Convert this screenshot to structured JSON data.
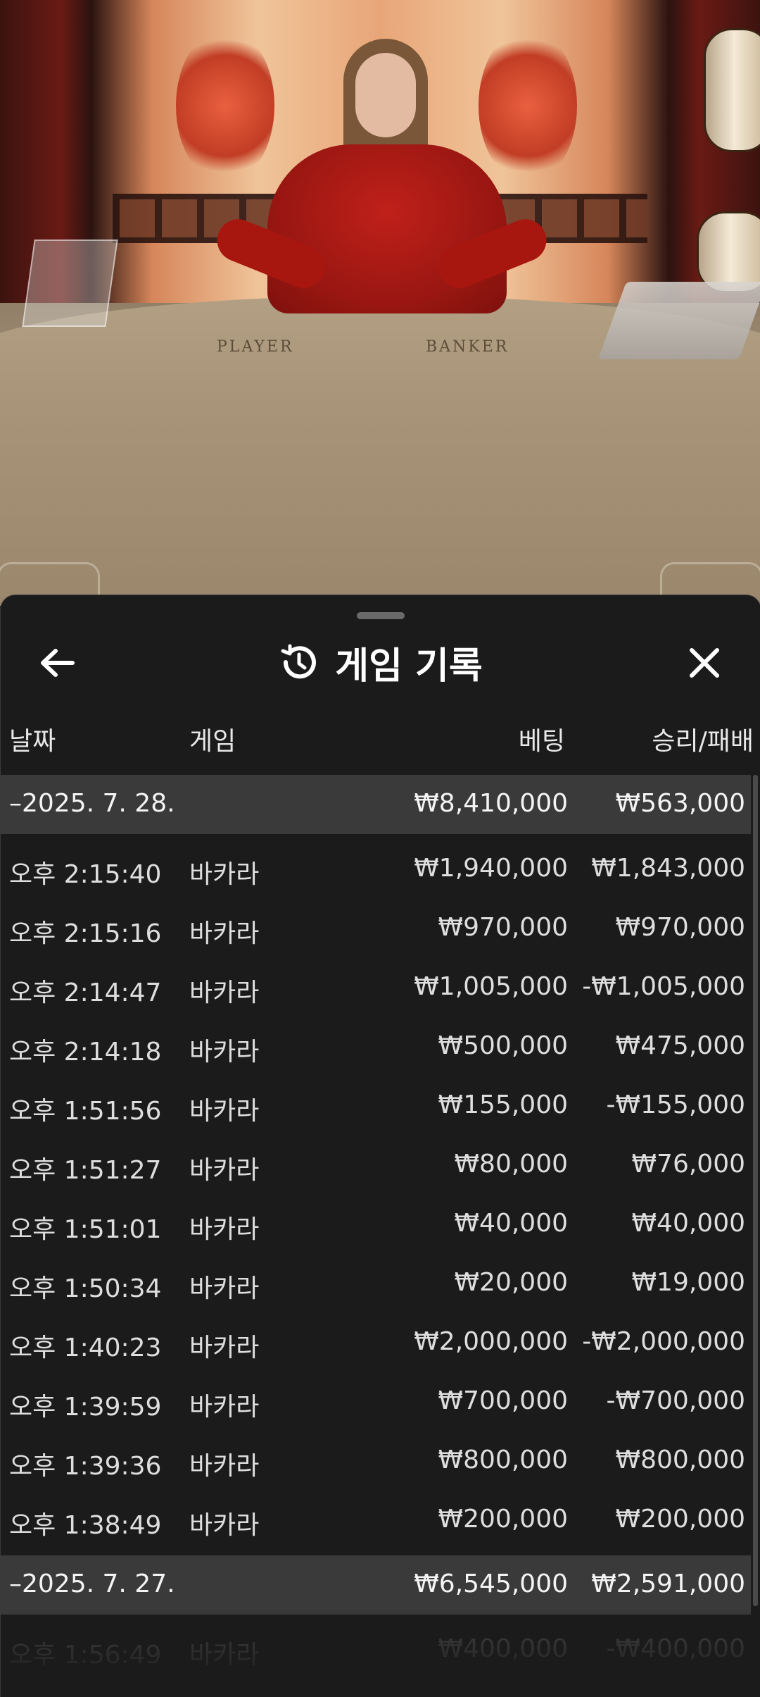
{
  "video": {
    "table_labels": [
      "PLAYER",
      "BANKER"
    ]
  },
  "header": {
    "title": "게임 기록",
    "back_icon": "arrow-left-icon",
    "history_icon": "history-icon",
    "close_icon": "close-icon"
  },
  "columns": {
    "date": "날짜",
    "game": "게임",
    "bet": "베팅",
    "win_loss": "승리/패배"
  },
  "groups": [
    {
      "date": "–2025. 7. 28.",
      "bet_total": "₩8,410,000",
      "win_total": "₩563,000",
      "rows": [
        {
          "time": "오후 2:15:40",
          "game": "바카라",
          "bet": "₩1,940,000",
          "win": "₩1,843,000"
        },
        {
          "time": "오후 2:15:16",
          "game": "바카라",
          "bet": "₩970,000",
          "win": "₩970,000"
        },
        {
          "time": "오후 2:14:47",
          "game": "바카라",
          "bet": "₩1,005,000",
          "win": "-₩1,005,000"
        },
        {
          "time": "오후 2:14:18",
          "game": "바카라",
          "bet": "₩500,000",
          "win": "₩475,000"
        },
        {
          "time": "오후 1:51:56",
          "game": "바카라",
          "bet": "₩155,000",
          "win": "-₩155,000"
        },
        {
          "time": "오후 1:51:27",
          "game": "바카라",
          "bet": "₩80,000",
          "win": "₩76,000"
        },
        {
          "time": "오후 1:51:01",
          "game": "바카라",
          "bet": "₩40,000",
          "win": "₩40,000"
        },
        {
          "time": "오후 1:50:34",
          "game": "바카라",
          "bet": "₩20,000",
          "win": "₩19,000"
        },
        {
          "time": "오후 1:40:23",
          "game": "바카라",
          "bet": "₩2,000,000",
          "win": "-₩2,000,000"
        },
        {
          "time": "오후 1:39:59",
          "game": "바카라",
          "bet": "₩700,000",
          "win": "-₩700,000"
        },
        {
          "time": "오후 1:39:36",
          "game": "바카라",
          "bet": "₩800,000",
          "win": "₩800,000"
        },
        {
          "time": "오후 1:38:49",
          "game": "바카라",
          "bet": "₩200,000",
          "win": "₩200,000"
        }
      ]
    },
    {
      "date": "–2025. 7. 27.",
      "bet_total": "₩6,545,000",
      "win_total": "₩2,591,000",
      "rows": [
        {
          "time": "오후 1:56:49",
          "game": "바카라",
          "bet": "₩400,000",
          "win": "-₩400,000"
        }
      ]
    }
  ]
}
